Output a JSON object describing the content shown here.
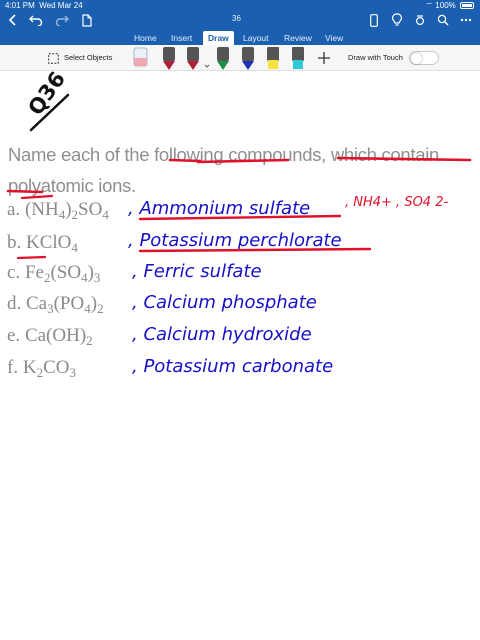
{
  "status": {
    "time": "4:01 PM",
    "date": "Wed Mar 24",
    "battery": "100%"
  },
  "toolbar": {
    "page_count": "36"
  },
  "tabs": [
    {
      "label": "Home"
    },
    {
      "label": "Insert"
    },
    {
      "label": "Draw"
    },
    {
      "label": "Layout"
    },
    {
      "label": "Review"
    },
    {
      "label": "View"
    }
  ],
  "ribbon": {
    "select_objects": "Select Objects",
    "draw_with_touch": "Draw with Touch"
  },
  "colors": {
    "app_bar": "#1b5fb0",
    "ink_blue": "#1610c9",
    "ink_red": "#e0122a",
    "ink_dark": "#111111",
    "pens": [
      "#e9f0f7",
      "#b0203a",
      "#1d8e4c",
      "#1f33b8",
      "#f3e33a",
      "#2fc9d6"
    ]
  },
  "page": {
    "label": "Q36",
    "question": "Name each of the following compounds, which contain polyatomic ions.",
    "compounds": [
      {
        "letter": "a.",
        "parts": [
          [
            "(NH",
            ""
          ],
          [
            "4",
            "sub"
          ],
          [
            ")",
            ""
          ],
          [
            "2",
            "sub"
          ],
          [
            "SO",
            ""
          ],
          [
            "4",
            "sub"
          ]
        ],
        "answer": ", Ammonium sulfate"
      },
      {
        "letter": "b.",
        "parts": [
          [
            "KClO",
            ""
          ],
          [
            "4",
            "sub"
          ]
        ],
        "answer": ", Potassium perchlorate"
      },
      {
        "letter": "c.",
        "parts": [
          [
            "Fe",
            ""
          ],
          [
            "2",
            "sub"
          ],
          [
            "(SO",
            ""
          ],
          [
            "4",
            "sub"
          ],
          [
            ")",
            ""
          ],
          [
            "3",
            "sub"
          ]
        ],
        "answer": ", Ferric sulfate"
      },
      {
        "letter": "d.",
        "parts": [
          [
            "Ca",
            ""
          ],
          [
            "3",
            "sub"
          ],
          [
            "(PO",
            ""
          ],
          [
            "4",
            "sub"
          ],
          [
            ")",
            ""
          ],
          [
            "2",
            "sub"
          ]
        ],
        "answer": ", Calcium phosphate"
      },
      {
        "letter": "e.",
        "parts": [
          [
            "Ca(OH)",
            ""
          ],
          [
            "2",
            "sub"
          ]
        ],
        "answer": ", Calcium hydroxide"
      },
      {
        "letter": "f.",
        "parts": [
          [
            "K",
            ""
          ],
          [
            "2",
            "sub"
          ],
          [
            "CO",
            ""
          ],
          [
            "3",
            "sub"
          ]
        ],
        "answer": ", Potassium carbonate"
      }
    ],
    "ions_note": ", NH4+ , SO4 2-"
  }
}
